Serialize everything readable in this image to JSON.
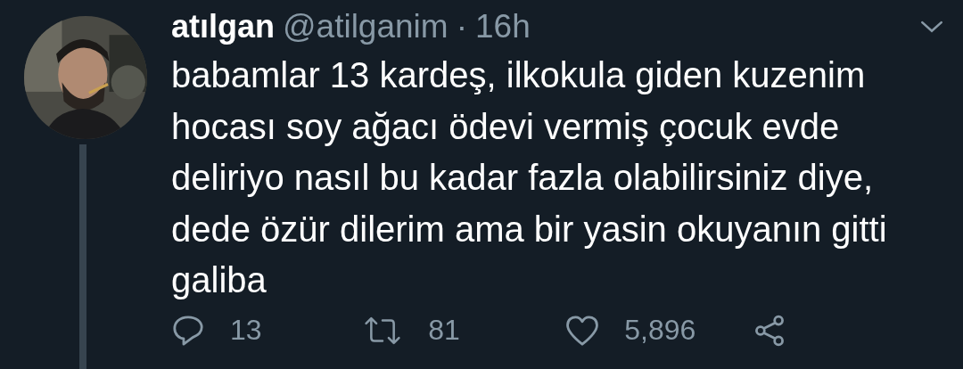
{
  "tweet": {
    "display_name": "atılgan",
    "handle": "@atilganim",
    "separator": "·",
    "time": "16h",
    "text": "babamlar 13 kardeş, ilkokula giden kuzenim\nhocası soy ağacı ödevi vermiş çocuk evde\ndeliriyo nasıl bu kadar fazla olabilirsiniz diye,\ndede özür dilerim ama bir yasin okuyanın gitti\ngaliba",
    "actions": [
      {
        "kind": "reply",
        "count": "13"
      },
      {
        "kind": "retweet",
        "count": "81"
      },
      {
        "kind": "like",
        "count": "5,896"
      },
      {
        "kind": "share"
      }
    ]
  }
}
